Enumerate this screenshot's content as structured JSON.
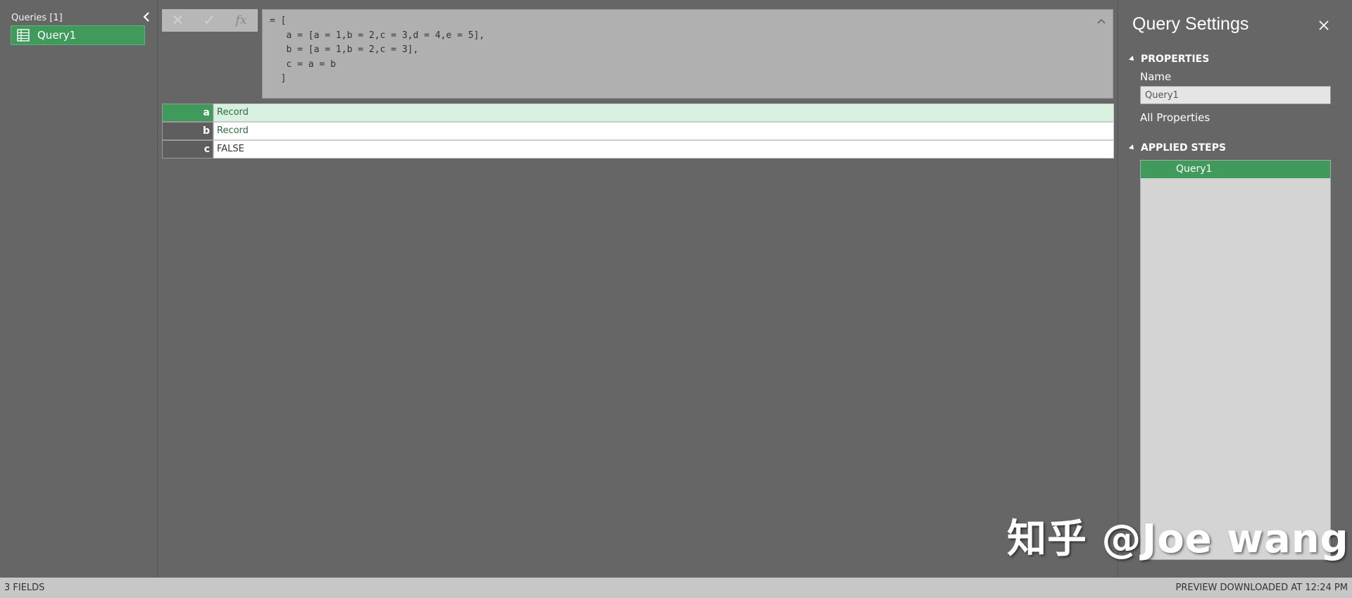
{
  "queries_pane": {
    "header": "Queries [1]",
    "items": [
      {
        "label": "Query1"
      }
    ]
  },
  "formula_bar": {
    "cancel_label": "✕",
    "commit_label": "✓",
    "fx_label": "fx",
    "formula": "= [\n   a = [a = 1,b = 2,c = 3,d = 4,e = 5],\n   b = [a = 1,b = 2,c = 3],\n   c = a = b\n  ]"
  },
  "record": {
    "rows": [
      {
        "key": "a",
        "value": "Record"
      },
      {
        "key": "b",
        "value": "Record"
      },
      {
        "key": "c",
        "value": "FALSE"
      }
    ]
  },
  "query_settings": {
    "title": "Query Settings",
    "properties_heading": "PROPERTIES",
    "name_label": "Name",
    "name_value": "Query1",
    "all_properties": "All Properties",
    "applied_steps_heading": "APPLIED STEPS",
    "steps": [
      {
        "label": "Query1"
      }
    ]
  },
  "status_bar": {
    "left": "3 FIELDS",
    "right": "PREVIEW DOWNLOADED AT 12:24 PM"
  },
  "watermark": "知乎 @Joe wang",
  "colors": {
    "accent": "#3f9a5c",
    "background": "#666666",
    "selected_row": "#d7f0e0"
  }
}
